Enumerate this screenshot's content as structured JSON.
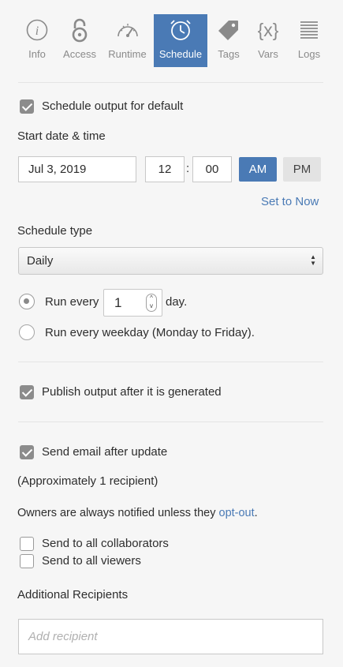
{
  "tabs": [
    {
      "key": "info",
      "label": "Info",
      "icon": "info-icon"
    },
    {
      "key": "access",
      "label": "Access",
      "icon": "lock-icon"
    },
    {
      "key": "runtime",
      "label": "Runtime",
      "icon": "speedometer-icon"
    },
    {
      "key": "schedule",
      "label": "Schedule",
      "icon": "clock-icon",
      "active": true
    },
    {
      "key": "tags",
      "label": "Tags",
      "icon": "tag-icon"
    },
    {
      "key": "vars",
      "label": "Vars",
      "icon": "variables-icon",
      "icon_text": "{x}"
    },
    {
      "key": "logs",
      "label": "Logs",
      "icon": "logs-icon"
    }
  ],
  "schedule_output": {
    "label": "Schedule output for default",
    "checked": true
  },
  "start": {
    "label": "Start date & time",
    "date": "Jul 3, 2019",
    "hour": "12",
    "separator": ":",
    "minute": "00",
    "am_label": "AM",
    "pm_label": "PM",
    "selected_period": "AM",
    "set_now_label": "Set to Now"
  },
  "schedule_type": {
    "label": "Schedule type",
    "selected": "Daily",
    "option_1": {
      "prefix": "Run every",
      "value": "1",
      "suffix": "day.",
      "selected": true
    },
    "option_2": {
      "label": "Run every weekday (Monday to Friday).",
      "selected": false
    }
  },
  "publish": {
    "label": "Publish output after it is generated",
    "checked": true
  },
  "email": {
    "label": "Send email after update",
    "checked": true,
    "recipient_count": "(Approximately 1 recipient)",
    "owners_note": "Owners are always notified unless they",
    "opt_out_link": "opt-out",
    "period": ".",
    "collaborators": {
      "label": "Send to all collaborators",
      "checked": false
    },
    "viewers": {
      "label": "Send to all viewers",
      "checked": false
    }
  },
  "additional": {
    "label": "Additional Recipients",
    "placeholder": "Add recipient"
  },
  "colors": {
    "accent": "#4a7ab5",
    "background": "#f6f6f6",
    "checkbox": "#8c8c8c"
  }
}
